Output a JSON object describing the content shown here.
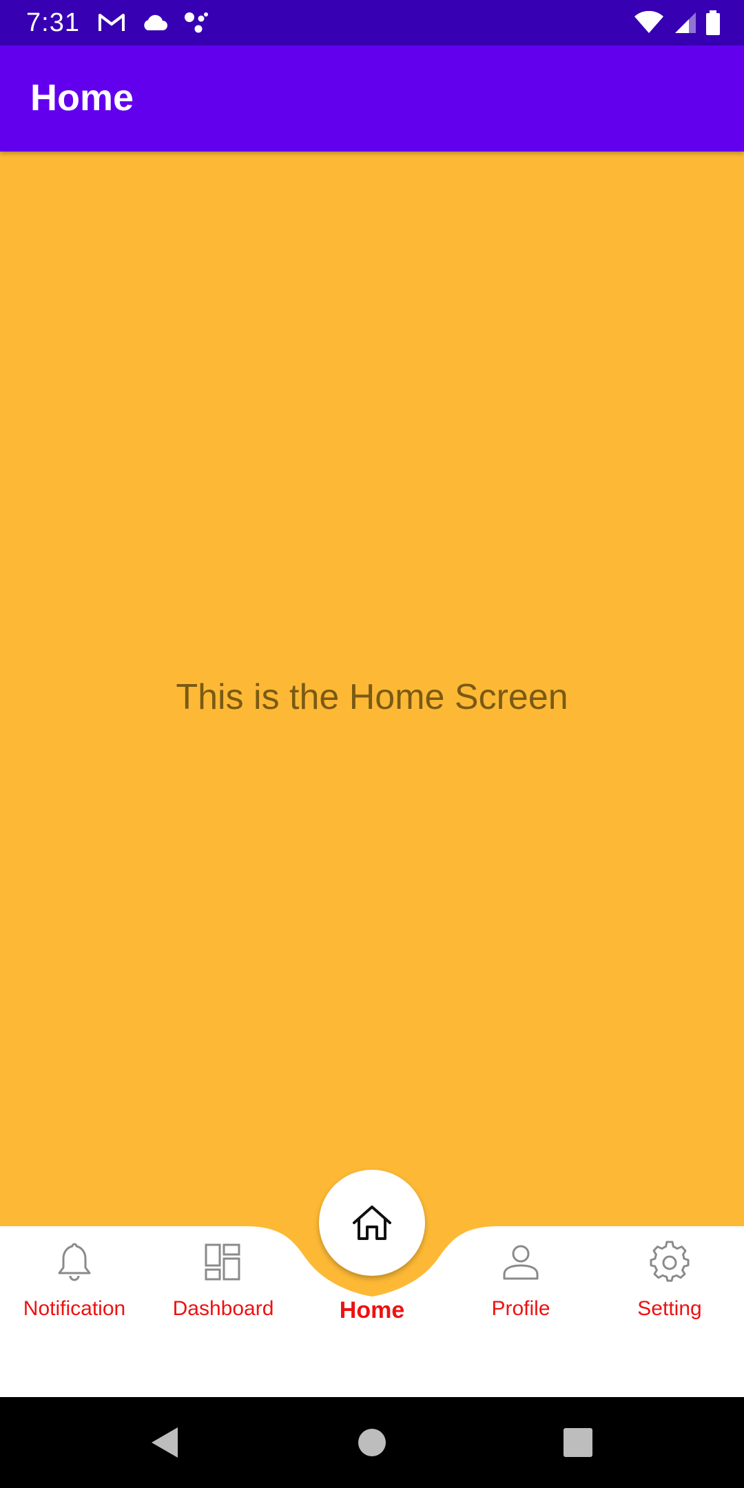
{
  "status_bar": {
    "time": "7:31",
    "left_icons": [
      "gmail-icon",
      "cloud-icon",
      "assistant-dots-icon"
    ],
    "right_icons": [
      "wifi-icon",
      "cell-signal-icon",
      "battery-icon"
    ],
    "color": "#3700B3"
  },
  "app_bar": {
    "title": "Home",
    "color": "#6200EE"
  },
  "main": {
    "message": "This is the Home Screen",
    "background": "#FDB935"
  },
  "bottom_nav": {
    "items": [
      {
        "label": "Notification",
        "icon": "bell-icon",
        "active": false
      },
      {
        "label": "Dashboard",
        "icon": "dashboard-icon",
        "active": false
      },
      {
        "label": "Home",
        "icon": "home-icon",
        "active": true
      },
      {
        "label": "Profile",
        "icon": "person-icon",
        "active": false
      },
      {
        "label": "Setting",
        "icon": "gear-icon",
        "active": false
      }
    ],
    "label_color": "#EE1111",
    "icon_color": "#8A8A8A"
  },
  "system_nav": {
    "buttons": [
      "back-icon",
      "home-circle-icon",
      "recents-icon"
    ]
  }
}
